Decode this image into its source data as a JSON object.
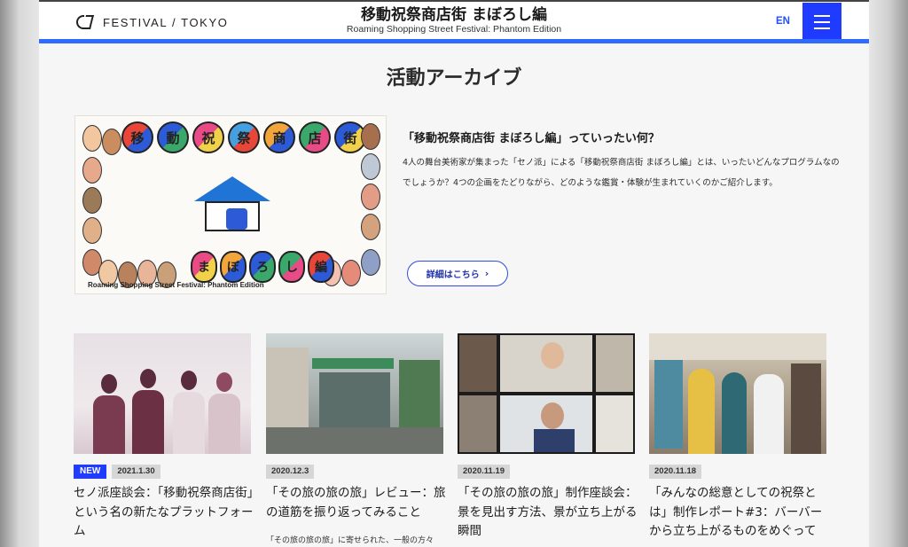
{
  "header": {
    "logo_text": "FESTIVAL / TOKYO",
    "title_ja": "移動祝祭商店街 まぼろし編",
    "title_en": "Roaming Shopping Street Festival: Phantom Edition",
    "lang": "EN",
    "menu_icon": "hamburger-icon"
  },
  "section_title": "活動アーカイブ",
  "feature": {
    "image_caption": "Roaming Shopping Street Festival: Phantom Edition",
    "image_title_chars": [
      "移",
      "動",
      "祝",
      "祭",
      "商",
      "店",
      "街"
    ],
    "image_sub_chars": [
      "ま",
      "ぼ",
      "ろ",
      "し",
      "編"
    ],
    "heading": "「移動祝祭商店街 まぼろし編」っていったい何？",
    "description": "4人の舞台美術家が集まった「セノ派」による「移動祝祭商店街 まぼろし編」とは、いったいどんなプログラムなのでしょうか？4つの企画をたどりながら、どのような鑑賞・体験が生まれていくのかご紹介します。",
    "button_label": "詳細はこちら"
  },
  "articles": [
    {
      "new_badge": "NEW",
      "date": "2021.1.30",
      "title": "セノ派座談会：「移動祝祭商店街」という名の新たなプラットフォーム",
      "excerpt": ""
    },
    {
      "new_badge": "",
      "date": "2020.12.3",
      "title": "「その旅の旅の旅」レビュー：旅の道筋を振り返ってみること",
      "excerpt": "「その旅の旅の旅」に寄せられた、一般の方々"
    },
    {
      "new_badge": "",
      "date": "2020.11.19",
      "title": "「その旅の旅の旅」制作座談会：景を見出す方法、景が立ち上がる瞬間",
      "excerpt": ""
    },
    {
      "new_badge": "",
      "date": "2020.11.18",
      "title": "「みんなの総意としての祝祭とは」制作レポート#3：バーバーから立ち上がるものをめぐって",
      "excerpt": ""
    }
  ],
  "colors": {
    "accent": "#1f3cff",
    "header_bar": "#2f6bff"
  }
}
